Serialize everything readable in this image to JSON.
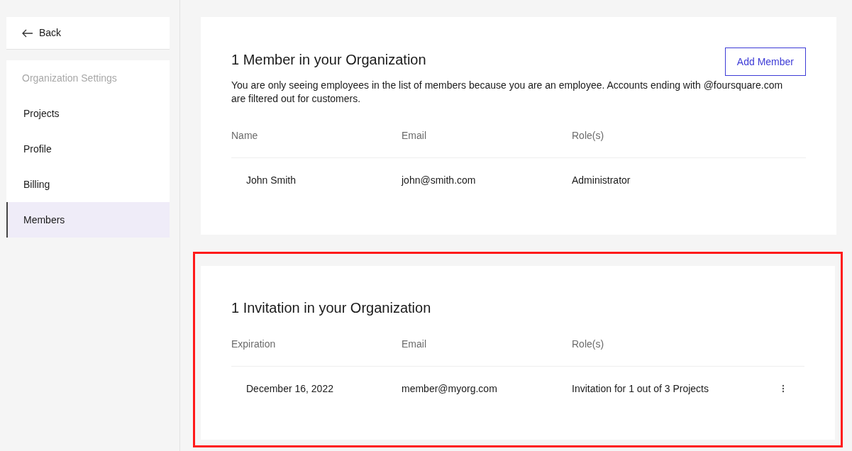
{
  "sidebar": {
    "back": {
      "label": "Back"
    },
    "heading": "Organization Settings",
    "items": [
      {
        "label": "Projects",
        "selected": false
      },
      {
        "label": "Profile",
        "selected": false
      },
      {
        "label": "Billing",
        "selected": false
      },
      {
        "label": "Members",
        "selected": true
      }
    ]
  },
  "members": {
    "title": "1 Member in your Organization",
    "add_button": "Add Member",
    "notice": "You are only seeing employees in the list of members because you are an employee. Accounts ending with @foursquare.com are filtered out for customers.",
    "columns": [
      "Name",
      "Email",
      "Role(s)"
    ],
    "rows": [
      {
        "cells": [
          "John Smith",
          "john@smith.com",
          "Administrator"
        ],
        "has_menu": false
      }
    ]
  },
  "invitations": {
    "title": "1 Invitation in your Organization",
    "highlighted": true,
    "columns": [
      "Expiration",
      "Email",
      "Role(s)"
    ],
    "rows": [
      {
        "cells": [
          "December 16, 2022",
          "member@myorg.com",
          "Invitation for 1 out of 3 Projects"
        ],
        "has_menu": true
      }
    ]
  }
}
